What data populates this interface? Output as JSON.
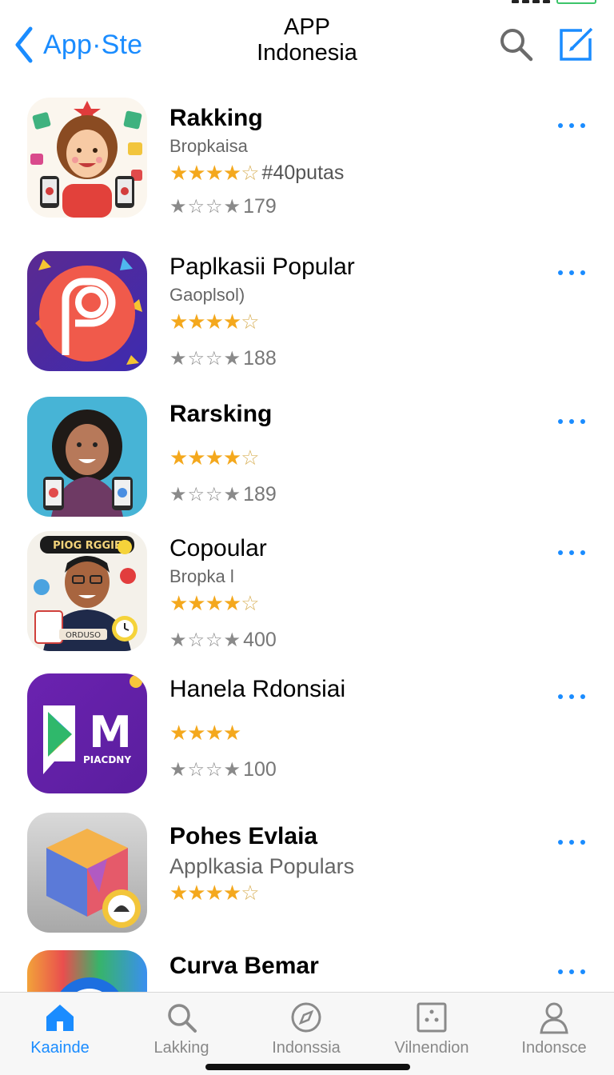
{
  "header": {
    "back_label": "App·Ste",
    "title_line1": "APP",
    "title_line2": "Indonesia"
  },
  "colors": {
    "accent": "#1a8cff",
    "star": "#f4a81d"
  },
  "apps": [
    {
      "name": "Rakking",
      "subtitle": "Bropkaisa",
      "rating_text": "#40putas",
      "stars": 4.5,
      "count_stars": "★☆☆★",
      "count": "179",
      "icon": "cartoon-woman-icon"
    },
    {
      "name": "Paplkasii Popular",
      "subtitle": "Gaoplsol)",
      "rating_text": "",
      "stars": 4.5,
      "count_stars": "★☆☆★",
      "count": "188",
      "icon": "camera-logo-icon"
    },
    {
      "name": "Rarsking",
      "subtitle": "",
      "rating_text": "",
      "stars": 4.5,
      "count_stars": "★☆☆★",
      "count": "189",
      "icon": "woman-portrait-icon"
    },
    {
      "name": "Copoular",
      "subtitle": "Bropka l",
      "rating_text": "",
      "stars": 4.5,
      "count_stars": "★☆☆★",
      "count": "400",
      "icon": "man-portrait-icon"
    },
    {
      "name": "Hanela Rdonsiai",
      "subtitle": "",
      "rating_text": "",
      "stars": 4,
      "count_stars": "★☆☆★",
      "count": "100",
      "icon": "play-m-logo-icon"
    },
    {
      "name": "Pohes Evlaia",
      "subtitle": "Applkasia Populars",
      "rating_text": "",
      "stars": 4.5,
      "count_stars": "",
      "count": "",
      "icon": "cube-icon"
    },
    {
      "name": "Curva Bemar",
      "subtitle": "",
      "rating_text": "",
      "stars": 0,
      "count_stars": "",
      "count": "",
      "icon": "rainbow-ring-icon"
    }
  ],
  "tabs": [
    {
      "label": "Kaainde",
      "icon": "home-icon",
      "active": true
    },
    {
      "label": "Lakking",
      "icon": "search-icon",
      "active": false
    },
    {
      "label": "Indonssia",
      "icon": "compass-icon",
      "active": false
    },
    {
      "label": "Vilnendion",
      "icon": "grid-icon",
      "active": false
    },
    {
      "label": "Indonsce",
      "icon": "person-icon",
      "active": false
    }
  ]
}
